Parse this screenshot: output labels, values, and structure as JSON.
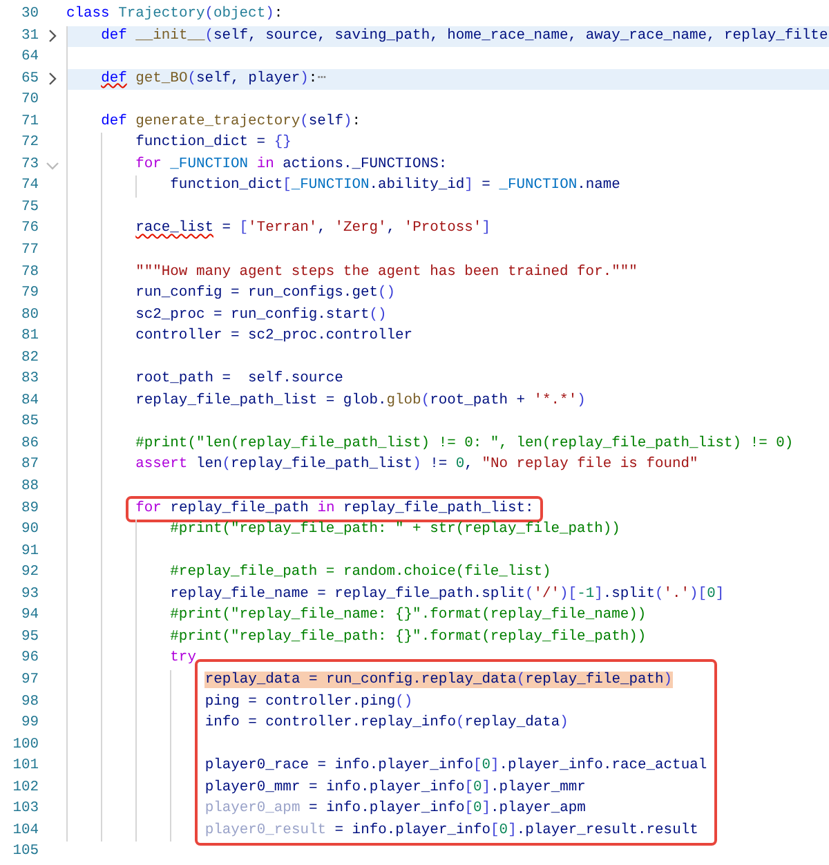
{
  "editor": {
    "blocks": [
      {
        "boxed": false,
        "lines": [
          {
            "number": "30",
            "selected": false,
            "tokens": [
              {
                "kind": "def",
                "text": "class "
              },
              {
                "kind": "cls",
                "text": "Trajectory"
              },
              {
                "kind": "br",
                "text": "("
              },
              {
                "kind": "cls",
                "text": "object"
              },
              {
                "kind": "br",
                "text": ")"
              },
              {
                "kind": "plain",
                "text": ":"
              }
            ]
          },
          {
            "number": "31",
            "fold": {
              "collapsed": true
            },
            "selected": false,
            "tokens": [
              {
                "kind": "def",
                "text": "    def "
              },
              {
                "kind": "fn",
                "text": "__init__"
              },
              {
                "kind": "br",
                "text": "("
              },
              {
                "kind": "var",
                "text": "self, source, saving_path, home_race_name, away_race_name, replay_filte"
              }
            ]
          },
          {
            "number": "64",
            "selected": false
          },
          {
            "number": "65",
            "fold": {
              "collapsed": true
            },
            "selected": false,
            "tokens": [
              {
                "kind": "def_error",
                "text": "    def"
              },
              {
                "kind": "fn",
                "text": " get_BO"
              },
              {
                "kind": "br",
                "text": "("
              },
              {
                "kind": "var",
                "text": "self, player"
              },
              {
                "kind": "br",
                "text": ")"
              },
              {
                "kind": "plain",
                "text": ":"
              },
              {
                "kind": "fold_dots",
                "text": "⋯"
              }
            ]
          },
          {
            "number": "70",
            "selected": false
          },
          {
            "number": "71",
            "selected": false,
            "tokens": [
              {
                "kind": "def",
                "text": "    def "
              },
              {
                "kind": "fn",
                "text": "generate_trajectory"
              },
              {
                "kind": "br",
                "text": "("
              },
              {
                "kind": "var",
                "text": "self"
              },
              {
                "kind": "br",
                "text": ")"
              },
              {
                "kind": "plain",
                "text": ":"
              }
            ]
          },
          {
            "number": "72",
            "selected": false,
            "tokens": [
              {
                "kind": "var",
                "text": "        function_dict = "
              },
              {
                "kind": "br",
                "text": "{}"
              }
            ]
          },
          {
            "number": "73",
            "fold": {
              "collapsed": false
            },
            "selected": false,
            "tokens": [
              {
                "kind": "kw",
                "text": "        for"
              },
              {
                "kind": "const",
                "text": " _FUNCTION "
              },
              {
                "kind": "kw",
                "text": "in"
              },
              {
                "kind": "var",
                "text": " actions._FUNCTIONS:"
              }
            ]
          },
          {
            "number": "74",
            "selected": false,
            "tokens": [
              {
                "kind": "var",
                "text": "            function_dict"
              },
              {
                "kind": "br",
                "text": "["
              },
              {
                "kind": "const",
                "text": "_FUNCTION"
              },
              {
                "kind": "var",
                "text": ".ability_id"
              },
              {
                "kind": "br",
                "text": "]"
              },
              {
                "kind": "var",
                "text": " = "
              },
              {
                "kind": "const",
                "text": "_FUNCTION"
              },
              {
                "kind": "var",
                "text": ".name"
              }
            ]
          },
          {
            "number": "75",
            "selected": false
          },
          {
            "number": "76",
            "selected": false,
            "tokens": [
              {
                "kind": "var_error",
                "text": "        race_list"
              },
              {
                "kind": "var",
                "text": " = "
              },
              {
                "kind": "br",
                "text": "["
              },
              {
                "kind": "str",
                "text": "'Terran'"
              },
              {
                "kind": "var",
                "text": ", "
              },
              {
                "kind": "str",
                "text": "'Zerg'"
              },
              {
                "kind": "var",
                "text": ", "
              },
              {
                "kind": "str",
                "text": "'Protoss'"
              },
              {
                "kind": "br",
                "text": "]"
              }
            ]
          },
          {
            "number": "77",
            "selected": false
          },
          {
            "number": "78",
            "selected": false,
            "tokens": [
              {
                "kind": "str",
                "text": "        \"\"\"How many agent steps the agent has been trained for.\"\"\""
              }
            ]
          },
          {
            "number": "79",
            "selected": false,
            "tokens": [
              {
                "kind": "var",
                "text": "        run_config = run_configs.get"
              },
              {
                "kind": "br",
                "text": "()"
              }
            ]
          },
          {
            "number": "80",
            "selected": false,
            "tokens": [
              {
                "kind": "var",
                "text": "        sc2_proc = run_config.start"
              },
              {
                "kind": "br",
                "text": "()"
              }
            ]
          },
          {
            "number": "81",
            "selected": false,
            "tokens": [
              {
                "kind": "var",
                "text": "        controller = sc2_proc.controller"
              }
            ]
          },
          {
            "number": "82",
            "selected": false
          },
          {
            "number": "83",
            "selected": false,
            "tokens": [
              {
                "kind": "var",
                "text": "        root_path =  self.source"
              }
            ]
          },
          {
            "number": "84",
            "selected": false,
            "tokens": [
              {
                "kind": "var",
                "text": "        replay_file_path_list = glob."
              },
              {
                "kind": "fn",
                "text": "glob"
              },
              {
                "kind": "br",
                "text": "("
              },
              {
                "kind": "var",
                "text": "root_path + "
              },
              {
                "kind": "str",
                "text": "'*.*'"
              },
              {
                "kind": "br",
                "text": ")"
              }
            ]
          },
          {
            "number": "85",
            "selected": false
          },
          {
            "number": "86",
            "selected": false,
            "tokens": [
              {
                "kind": "cmt",
                "text": "        #print(\"len(replay_file_path_list) != 0: \", len(replay_file_path_list) != 0)"
              }
            ]
          },
          {
            "number": "87",
            "selected": false,
            "tokens": [
              {
                "kind": "kw",
                "text": "        assert"
              },
              {
                "kind": "var",
                "text": " len"
              },
              {
                "kind": "br",
                "text": "("
              },
              {
                "kind": "var",
                "text": "replay_file_path_list"
              },
              {
                "kind": "br",
                "text": ")"
              },
              {
                "kind": "var",
                "text": " != "
              },
              {
                "kind": "num",
                "text": "0"
              },
              {
                "kind": "var",
                "text": ", "
              },
              {
                "kind": "str",
                "text": "\"No replay file is found\""
              }
            ]
          },
          {
            "number": "88",
            "selected": false
          }
        ]
      },
      {
        "boxed": true,
        "lines": [
          {
            "number": "89",
            "selected": false,
            "tokens": [
              {
                "kind": "kw",
                "text": "        for"
              },
              {
                "kind": "var",
                "text": " replay_file_path "
              },
              {
                "kind": "kw",
                "text": "in"
              },
              {
                "kind": "var",
                "text": " replay_file_path_list:"
              }
            ]
          }
        ]
      },
      {
        "boxed": false,
        "lines": [
          {
            "number": "90",
            "selected": false,
            "tokens": [
              {
                "kind": "cmt",
                "text": "            #print(\"replay_file_path: \" + str(replay_file_path))"
              }
            ]
          },
          {
            "number": "91",
            "selected": false
          },
          {
            "number": "92",
            "selected": false,
            "tokens": [
              {
                "kind": "cmt",
                "text": "            #replay_file_path = random.choice(file_list)"
              }
            ]
          },
          {
            "number": "93",
            "selected": false,
            "tokens": [
              {
                "kind": "var",
                "text": "            replay_file_name = replay_file_path.split"
              },
              {
                "kind": "br",
                "text": "("
              },
              {
                "kind": "str",
                "text": "'/'"
              },
              {
                "kind": "br",
                "text": ")["
              },
              {
                "kind": "num",
                "text": "-1"
              },
              {
                "kind": "br",
                "text": "]"
              },
              {
                "kind": "var",
                "text": ".split"
              },
              {
                "kind": "br",
                "text": "("
              },
              {
                "kind": "str",
                "text": "'.'"
              },
              {
                "kind": "br",
                "text": ")["
              },
              {
                "kind": "num",
                "text": "0"
              },
              {
                "kind": "br",
                "text": "]"
              }
            ]
          },
          {
            "number": "94",
            "selected": false,
            "tokens": [
              {
                "kind": "cmt",
                "text": "            #print(\"replay_file_name: {}\".format(replay_file_name))"
              }
            ]
          },
          {
            "number": "95",
            "selected": false,
            "tokens": [
              {
                "kind": "cmt",
                "text": "            #print(\"replay_file_path: {}\".format(replay_file_path))"
              }
            ]
          },
          {
            "number": "96",
            "selected": false,
            "tokens": [
              {
                "kind": "kw",
                "text": "            try"
              }
            ]
          }
        ]
      },
      {
        "boxed": true,
        "lines": [
          {
            "number": "97",
            "selected": true,
            "tokens": [
              {
                "kind": "var",
                "text": "                replay_data = run_config.replay_data"
              },
              {
                "kind": "br",
                "text": "("
              },
              {
                "kind": "var",
                "text": "replay_file_path"
              },
              {
                "kind": "br",
                "text": ")"
              }
            ]
          },
          {
            "number": "98",
            "selected": false,
            "tokens": [
              {
                "kind": "var",
                "text": "                ping = controller.ping"
              },
              {
                "kind": "br",
                "text": "()"
              }
            ]
          },
          {
            "number": "99",
            "selected": false,
            "tokens": [
              {
                "kind": "var",
                "text": "                info = controller.replay_info"
              },
              {
                "kind": "br",
                "text": "("
              },
              {
                "kind": "var",
                "text": "replay_data"
              },
              {
                "kind": "br",
                "text": ")"
              }
            ]
          },
          {
            "number": "100",
            "selected": false
          },
          {
            "number": "101",
            "selected": false,
            "tokens": [
              {
                "kind": "var",
                "text": "                player0_race = info.player_info"
              },
              {
                "kind": "br",
                "text": "["
              },
              {
                "kind": "num",
                "text": "0"
              },
              {
                "kind": "br",
                "text": "]"
              },
              {
                "kind": "var",
                "text": ".player_info.race_actual"
              }
            ]
          },
          {
            "number": "102",
            "selected": false,
            "tokens": [
              {
                "kind": "var",
                "text": "                player0_mmr = info.player_info"
              },
              {
                "kind": "br",
                "text": "["
              },
              {
                "kind": "num",
                "text": "0"
              },
              {
                "kind": "br",
                "text": "]"
              },
              {
                "kind": "var",
                "text": ".player_mmr"
              }
            ]
          },
          {
            "number": "103",
            "selected": false,
            "tokens": [
              {
                "kind": "dim",
                "text": "                player0_apm"
              },
              {
                "kind": "var",
                "text": " = info.player_info"
              },
              {
                "kind": "br",
                "text": "["
              },
              {
                "kind": "num",
                "text": "0"
              },
              {
                "kind": "br",
                "text": "]"
              },
              {
                "kind": "var",
                "text": ".player_apm"
              }
            ]
          },
          {
            "number": "104",
            "selected": false,
            "tokens": [
              {
                "kind": "dim",
                "text": "                player0_result"
              },
              {
                "kind": "var",
                "text": " = info.player_info"
              },
              {
                "kind": "br",
                "text": "["
              },
              {
                "kind": "num",
                "text": "0"
              },
              {
                "kind": "br",
                "text": "]"
              },
              {
                "kind": "var",
                "text": ".player_result.result"
              }
            ]
          }
        ]
      },
      {
        "boxed": false,
        "lines": [
          {
            "number": "105",
            "selected": false
          }
        ]
      }
    ]
  }
}
